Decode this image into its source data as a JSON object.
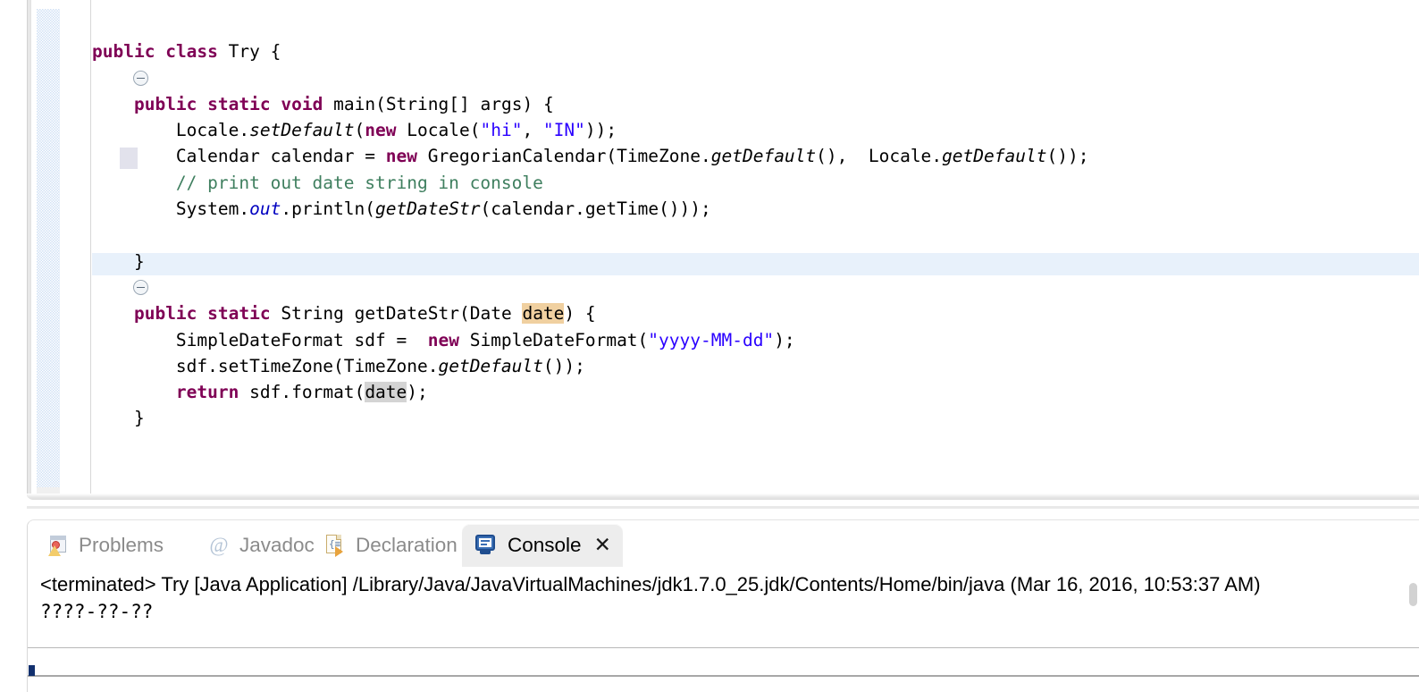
{
  "editor": {
    "language": "java",
    "class_name": "Try",
    "folding": {
      "collapse_icon": "collapse-minus-icon",
      "rows": [
        2,
        11
      ]
    },
    "current_line_highlight": true,
    "occurrence_highlight_word": "date",
    "code_lines": [
      {
        "id": 1,
        "text": "public class Try {"
      },
      {
        "id": 2,
        "text": ""
      },
      {
        "id": 3,
        "text": "    public static void main(String[] args) {"
      },
      {
        "id": 4,
        "text": "        Locale.setDefault(new Locale(\"hi\", \"IN\"));"
      },
      {
        "id": 5,
        "text": "        Calendar calendar = new GregorianCalendar(TimeZone.getDefault(),  Locale.getDefault());"
      },
      {
        "id": 6,
        "text": "        // print out date string in console"
      },
      {
        "id": 7,
        "text": "        System.out.println(getDateStr(calendar.getTime()));"
      },
      {
        "id": 8,
        "text": ""
      },
      {
        "id": 9,
        "text": "    }"
      },
      {
        "id": 10,
        "text": ""
      },
      {
        "id": 11,
        "text": "    public static String getDateStr(Date date) {"
      },
      {
        "id": 12,
        "text": "        SimpleDateFormat sdf =  new SimpleDateFormat(\"yyyy-MM-dd\");"
      },
      {
        "id": 13,
        "text": "        sdf.setTimeZone(TimeZone.getDefault());"
      },
      {
        "id": 14,
        "text": "        return sdf.format(date);"
      },
      {
        "id": 15,
        "text": "    }"
      },
      {
        "id": 16,
        "text": ""
      },
      {
        "id": 17,
        "text": ""
      },
      {
        "id": 18,
        "text": ""
      },
      {
        "id": 19,
        "text": "}"
      }
    ],
    "tokens": {
      "kw_public": "public",
      "kw_class": "class",
      "kw_static": "static",
      "kw_void": "void",
      "kw_new": "new",
      "kw_return": "return",
      "type_String": "String",
      "name_Try": "Try",
      "name_main": "main",
      "name_args": "args",
      "name_Locale": "Locale",
      "name_setDefault": "setDefault",
      "str_hi": "\"hi\"",
      "str_IN": "\"IN\"",
      "name_Calendar": "Calendar",
      "name_calendar": "calendar",
      "name_GregorianCalendar": "GregorianCalendar",
      "name_TimeZone": "TimeZone",
      "name_getDefault": "getDefault",
      "comment": "// print out date string in console",
      "name_System": "System",
      "field_out": "out",
      "name_println": "println",
      "name_getDateStr": "getDateStr",
      "name_getTime": "getTime",
      "type_Date": "Date",
      "name_date": "date",
      "name_SimpleDateFormat": "SimpleDateFormat",
      "name_sdf": "sdf",
      "str_pattern": "\"yyyy-MM-dd\"",
      "name_setTimeZone": "setTimeZone",
      "name_format": "format"
    },
    "colors": {
      "keyword": "#7F0055",
      "string": "#2A00FF",
      "comment": "#3F7F5F",
      "field": "#0000C0",
      "plain": "#000000",
      "current_line": "#E8F1FB",
      "occurrence_write": "#F0D0A0",
      "occurrence_read": "#D4D4D4",
      "change_ribbon": "#CFE0F5",
      "background": "#FFFFFF"
    }
  },
  "bottom_panel": {
    "tabs": [
      {
        "id": "problems",
        "label": "Problems",
        "icon": "problems-icon",
        "active": false,
        "closable": false
      },
      {
        "id": "javadoc",
        "label": "Javadoc",
        "icon": "javadoc-at-icon",
        "active": false,
        "closable": false
      },
      {
        "id": "declaration",
        "label": "Declaration",
        "icon": "declaration-icon",
        "active": false,
        "closable": false
      },
      {
        "id": "console",
        "label": "Console",
        "icon": "console-icon",
        "active": true,
        "closable": true
      }
    ],
    "close_glyph": "✕",
    "console": {
      "header_line": "<terminated> Try [Java Application] /Library/Java/JavaVirtualMachines/jdk1.7.0_25.jdk/Contents/Home/bin/java (Mar 16, 2016, 10:53:37 AM)",
      "output_lines": [
        "????-??-??"
      ]
    }
  }
}
